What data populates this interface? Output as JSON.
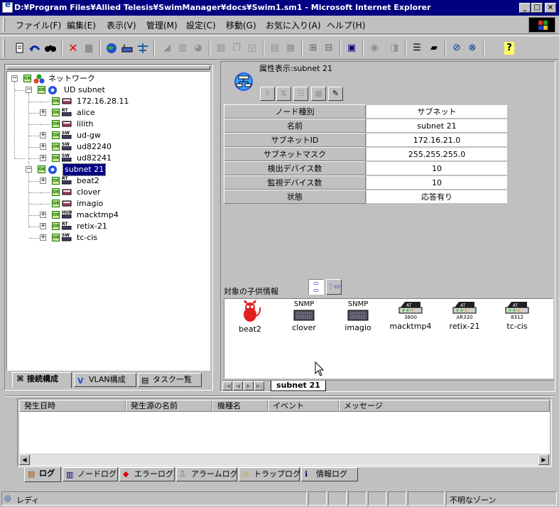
{
  "window": {
    "title": "D:¥Program Files¥Allied Telesis¥SwimManager¥docs¥Swim1.sm1 - Microsoft Internet Explorer",
    "min_glyph": "_",
    "max_glyph": "□",
    "close_glyph": "×"
  },
  "menu": [
    {
      "label": "ファイル(F)"
    },
    {
      "label": "編集(E)"
    },
    {
      "label": "表示(V)"
    },
    {
      "label": "管理(M)"
    },
    {
      "label": "設定(C)"
    },
    {
      "label": "移動(G)"
    },
    {
      "label": "お気に入り(A)"
    },
    {
      "label": "ヘルプ(H)"
    }
  ],
  "toolbar_icons": [
    "properties-icon",
    "back-icon",
    "find-icon",
    "delete-icon",
    "stamp-icon",
    "globe-icon",
    "router-icon",
    "network-icon",
    "chart-area-icon",
    "chart-bar-icon",
    "chart-pie-icon",
    "image-icon",
    "copy-icon",
    "graph-icon",
    "bar-edit-icon",
    "bar-check-icon",
    "port-icon",
    "port-config-icon",
    "save-icon",
    "refresh-icon",
    "stop-icon",
    "list-icon",
    "disk-icon",
    "vlan-icon",
    "vlan-edit-icon",
    "help-icon"
  ],
  "tree": {
    "root": {
      "label": "ネットワーク",
      "ok": "OK"
    },
    "ud_subnet": {
      "label": "UD subnet",
      "ok": "OK"
    },
    "ud_children": [
      {
        "label": "172.16.28.11",
        "ok": "OK",
        "type": "PC",
        "expander": ""
      },
      {
        "label": "alice",
        "ok": "OK",
        "type": "RT",
        "expander": "+"
      },
      {
        "label": "lilith",
        "ok": "OK",
        "type": "PC",
        "expander": ""
      },
      {
        "label": "ud-gw",
        "ok": "OK",
        "type": "SW",
        "expander": "+"
      },
      {
        "label": "ud82240",
        "ok": "OK",
        "type": "SW",
        "expander": "+"
      },
      {
        "label": "ud82241",
        "ok": "OK",
        "type": "SW",
        "expander": "+"
      }
    ],
    "subnet21": {
      "label": "subnet 21",
      "ok": "OK"
    },
    "subnet21_children": [
      {
        "label": "beat2",
        "ok": "OK",
        "type": "RT",
        "expander": "+"
      },
      {
        "label": "clover",
        "ok": "OK",
        "type": "PC",
        "expander": ""
      },
      {
        "label": "imagio",
        "ok": "OK",
        "type": "PC",
        "expander": ""
      },
      {
        "label": "macktmp4",
        "ok": "OK",
        "type": "HUB",
        "expander": "+"
      },
      {
        "label": "retix-21",
        "ok": "OK",
        "type": "RT",
        "expander": "+"
      },
      {
        "label": "tc-cis",
        "ok": "OK",
        "type": "SW",
        "expander": "+"
      }
    ]
  },
  "left_tabs": [
    {
      "label": "接続構成"
    },
    {
      "label": "VLAN構成"
    },
    {
      "label": "タスク一覧"
    }
  ],
  "properties": {
    "title": "属性表示:subnet 21",
    "rows": [
      {
        "key": "ノード種別",
        "value": "サブネット"
      },
      {
        "key": "名前",
        "value": "subnet 21"
      },
      {
        "key": "サブネットID",
        "value": "172.16.21.0"
      },
      {
        "key": "サブネットマスク",
        "value": "255.255.255.0"
      },
      {
        "key": "検出デバイス数",
        "value": "10"
      },
      {
        "key": "監視デバイス数",
        "value": "10"
      },
      {
        "key": "状態",
        "value": "応答有り"
      }
    ]
  },
  "children": {
    "title": "対象の子供情報",
    "items": [
      {
        "label": "beat2",
        "caption": ""
      },
      {
        "label": "clover",
        "caption": "SNMP"
      },
      {
        "label": "imagio",
        "caption": "SNMP"
      },
      {
        "label": "macktmp4",
        "caption": "3600"
      },
      {
        "label": "retix-21",
        "caption": "AR320"
      },
      {
        "label": "tc-cis",
        "caption": "8312"
      }
    ]
  },
  "sheet_tab": "subnet 21",
  "log": {
    "headers": [
      "発生日時",
      "発生源の名前",
      "機種名",
      "イベント",
      "メッセージ"
    ]
  },
  "log_tabs": [
    {
      "label": "ログ"
    },
    {
      "label": "ノードログ"
    },
    {
      "label": "エラーログ"
    },
    {
      "label": "アラームログ"
    },
    {
      "label": "トラップログ"
    },
    {
      "label": "情報ログ"
    }
  ],
  "status": {
    "left": "レディ",
    "zone": "不明なゾーン"
  },
  "badges": {
    "snmp": "SNMP",
    "ok": "OK"
  }
}
